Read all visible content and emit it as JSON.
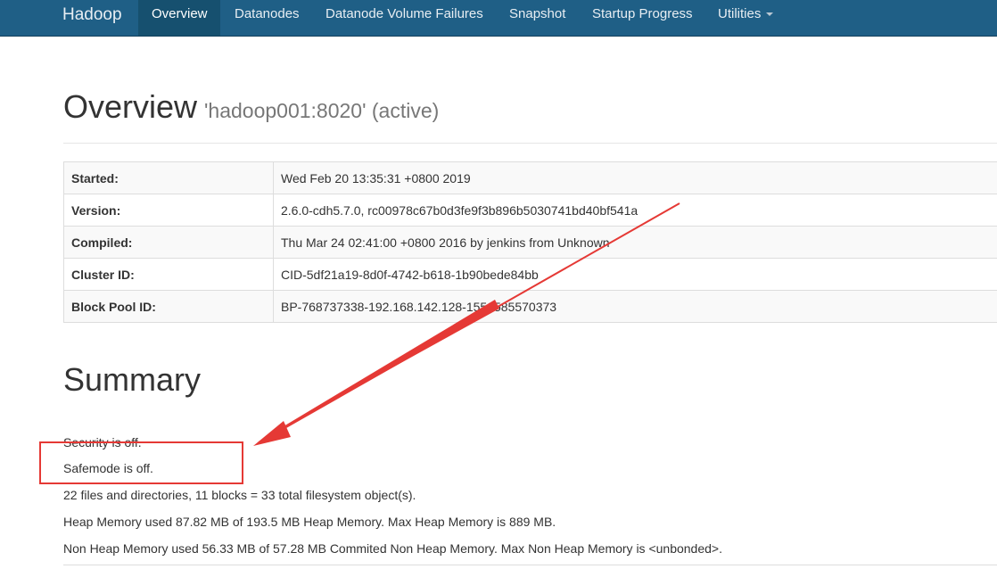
{
  "navbar": {
    "brand": "Hadoop",
    "items": [
      {
        "label": "Overview"
      },
      {
        "label": "Datanodes"
      },
      {
        "label": "Datanode Volume Failures"
      },
      {
        "label": "Snapshot"
      },
      {
        "label": "Startup Progress"
      },
      {
        "label": "Utilities"
      }
    ]
  },
  "header": {
    "title": "Overview",
    "subtitle": "'hadoop001:8020' (active)"
  },
  "info": {
    "rows": [
      {
        "label": "Started:",
        "value": "Wed Feb 20 13:35:31 +0800 2019"
      },
      {
        "label": "Version:",
        "value": "2.6.0-cdh5.7.0, rc00978c67b0d3fe9f3b896b5030741bd40bf541a"
      },
      {
        "label": "Compiled:",
        "value": "Thu Mar 24 02:41:00 +0800 2016 by jenkins from Unknown"
      },
      {
        "label": "Cluster ID:",
        "value": "CID-5df21a19-8d0f-4742-b618-1b90bede84bb"
      },
      {
        "label": "Block Pool ID:",
        "value": "BP-768737338-192.168.142.128-1550585570373"
      }
    ]
  },
  "summary": {
    "title": "Summary",
    "security": "Security is off.",
    "safemode": "Safemode is off.",
    "files": "22 files and directories, 11 blocks = 33 total filesystem object(s).",
    "heap": "Heap Memory used 87.82 MB of 193.5 MB Heap Memory. Max Heap Memory is 889 MB.",
    "nonheap": "Non Heap Memory used 56.33 MB of 57.28 MB Commited Non Heap Memory. Max Non Heap Memory is <unbonded>."
  },
  "colors": {
    "navbar": "#1f5f86",
    "navbar_active": "#16506f",
    "annotation": "#e53935"
  }
}
